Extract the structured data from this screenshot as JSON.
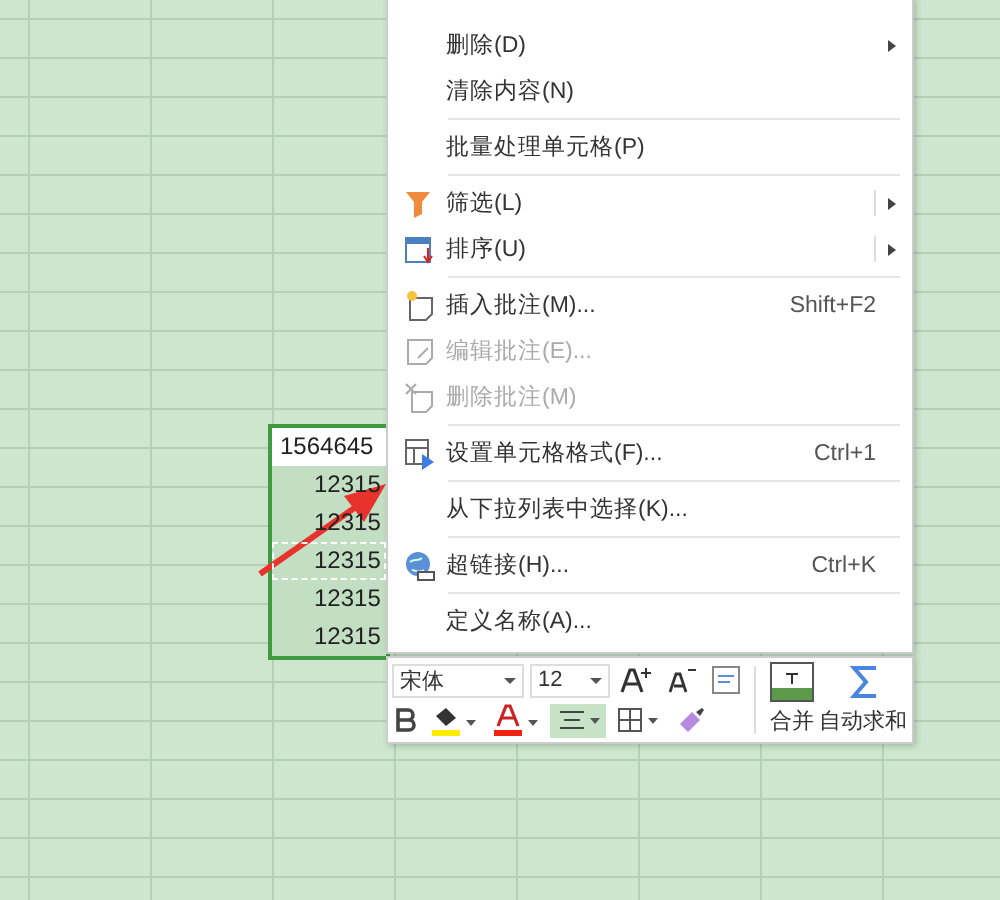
{
  "sheet": {
    "selection_cells": [
      "1564645",
      "12315",
      "12315",
      "12315",
      "12315",
      "12315"
    ]
  },
  "context_menu": {
    "items": [
      {
        "kind": "item",
        "label": "删除(D)",
        "submenu": true,
        "split": false,
        "disabled": false
      },
      {
        "kind": "item",
        "label": "清除内容(N)",
        "submenu": false,
        "split": false,
        "disabled": false
      },
      {
        "kind": "separator"
      },
      {
        "kind": "item",
        "label": "批量处理单元格(P)",
        "submenu": false,
        "split": false,
        "disabled": false
      },
      {
        "kind": "separator"
      },
      {
        "kind": "item",
        "label": "筛选(L)",
        "submenu": true,
        "split": true,
        "disabled": false
      },
      {
        "kind": "item",
        "label": "排序(U)",
        "submenu": true,
        "split": true,
        "disabled": false
      },
      {
        "kind": "separator"
      },
      {
        "kind": "item",
        "label": "插入批注(M)...",
        "shortcut": "Shift+F2",
        "submenu": false,
        "split": false,
        "disabled": false
      },
      {
        "kind": "item",
        "label": "编辑批注(E)...",
        "submenu": false,
        "split": false,
        "disabled": true
      },
      {
        "kind": "item",
        "label": "删除批注(M)",
        "submenu": false,
        "split": false,
        "disabled": true
      },
      {
        "kind": "separator"
      },
      {
        "kind": "item",
        "label": "设置单元格格式(F)...",
        "shortcut": "Ctrl+1",
        "submenu": false,
        "split": false,
        "disabled": false
      },
      {
        "kind": "separator"
      },
      {
        "kind": "item",
        "label": "从下拉列表中选择(K)...",
        "submenu": false,
        "split": false,
        "disabled": false
      },
      {
        "kind": "separator"
      },
      {
        "kind": "item",
        "label": "超链接(H)...",
        "shortcut": "Ctrl+K",
        "submenu": false,
        "split": false,
        "disabled": false
      },
      {
        "kind": "separator"
      },
      {
        "kind": "item",
        "label": "定义名称(A)...",
        "submenu": false,
        "split": false,
        "disabled": false
      }
    ]
  },
  "mini_toolbar": {
    "font": "宋体",
    "size": "12",
    "align_center": {
      "selected": true
    },
    "merge_label": "合并",
    "autosum_label": "自动求和"
  }
}
